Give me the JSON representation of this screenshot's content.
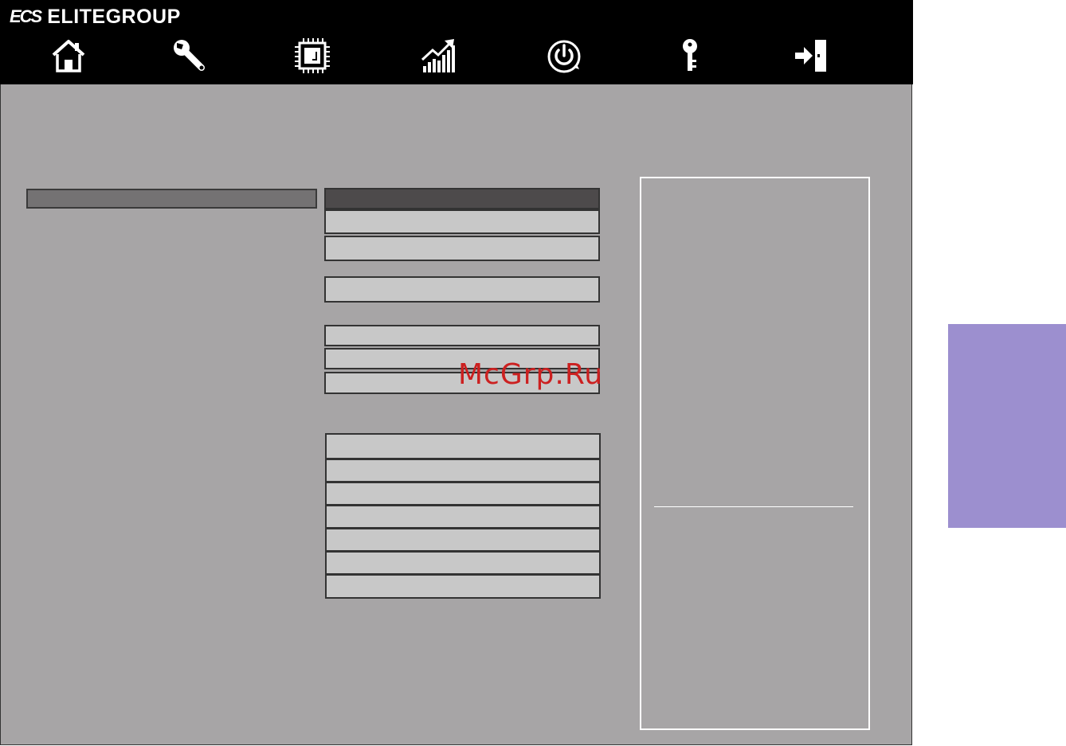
{
  "brand": {
    "mark": "ECS",
    "name": "ELITEGROUP"
  },
  "nav": [
    {
      "icon": "home-icon"
    },
    {
      "icon": "wrench-icon"
    },
    {
      "icon": "chip-icon"
    },
    {
      "icon": "performance-chart-icon"
    },
    {
      "icon": "power-icon"
    },
    {
      "icon": "key-icon"
    },
    {
      "icon": "exit-icon"
    }
  ],
  "watermark": "McGrp.Ru",
  "colors": {
    "topbar": "#000000",
    "panel": "#a7a5a6",
    "field": "#c8c8c8",
    "field_selected": "#4d4a4b",
    "side_tab": "#9c8fcf"
  }
}
